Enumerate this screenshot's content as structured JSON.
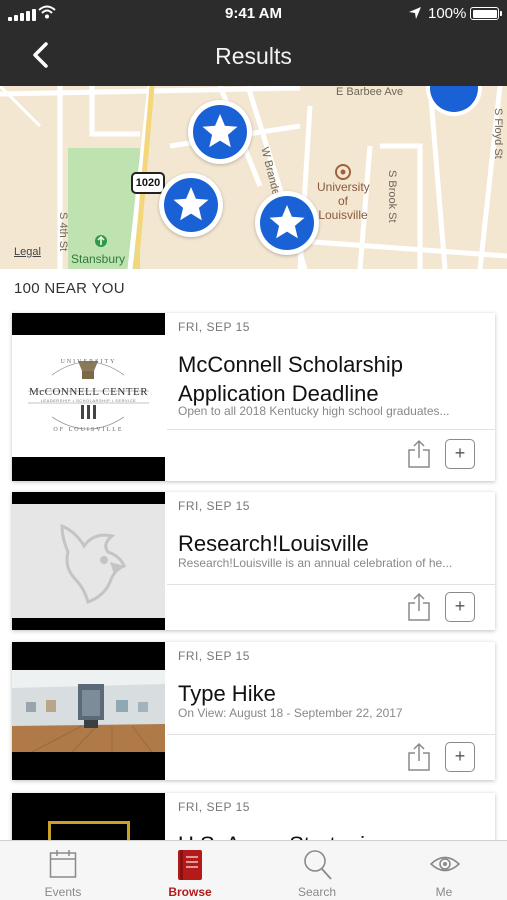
{
  "status_bar": {
    "time": "9:41 AM",
    "battery": "100%"
  },
  "header": {
    "title": "Results",
    "back_icon": "chevron-left-icon"
  },
  "map": {
    "street_labels": [
      "E Barbee Ave",
      "W Brandeis Ave",
      "S Brook St",
      "S Floyd St",
      "S 4th St"
    ],
    "highway_shield": "1020",
    "poi_university": "University of Louisville",
    "poi_park": "Stansbury",
    "legal": "Legal",
    "pin_icon": "star-icon",
    "pin_color": "#1a61d6"
  },
  "results": {
    "count_label": "100 NEAR YOU"
  },
  "events": [
    {
      "date": "FRI, SEP 15",
      "title": "McConnell Scholarship Application Deadline",
      "description": "Open to all 2018 Kentucky high school graduates...",
      "image_text_top": "UNIVERSITY",
      "image_text_main": "McCONNELL CENTER",
      "image_text_sub": "LEADERSHIP • SCHOLARSHIP • SERVICE",
      "image_text_bottom": "OF LOUISVILLE"
    },
    {
      "date": "FRI, SEP 15",
      "title": "Research!Louisville",
      "description": "Research!Louisville is an annual celebration of he..."
    },
    {
      "date": "FRI, SEP 15",
      "title": "Type Hike",
      "description": "On View:  August 18 - September 22, 2017"
    },
    {
      "date": "FRI, SEP 15",
      "title": "U.S. Army: Strategic"
    }
  ],
  "tabs": [
    {
      "label": "Events",
      "icon": "calendar-icon"
    },
    {
      "label": "Browse",
      "icon": "book-icon",
      "active": true
    },
    {
      "label": "Search",
      "icon": "search-icon"
    },
    {
      "label": "Me",
      "icon": "eye-icon"
    }
  ],
  "colors": {
    "nav_bar": "#2c2c2c",
    "accent": "#b31a1a",
    "pin": "#1a61d6"
  }
}
